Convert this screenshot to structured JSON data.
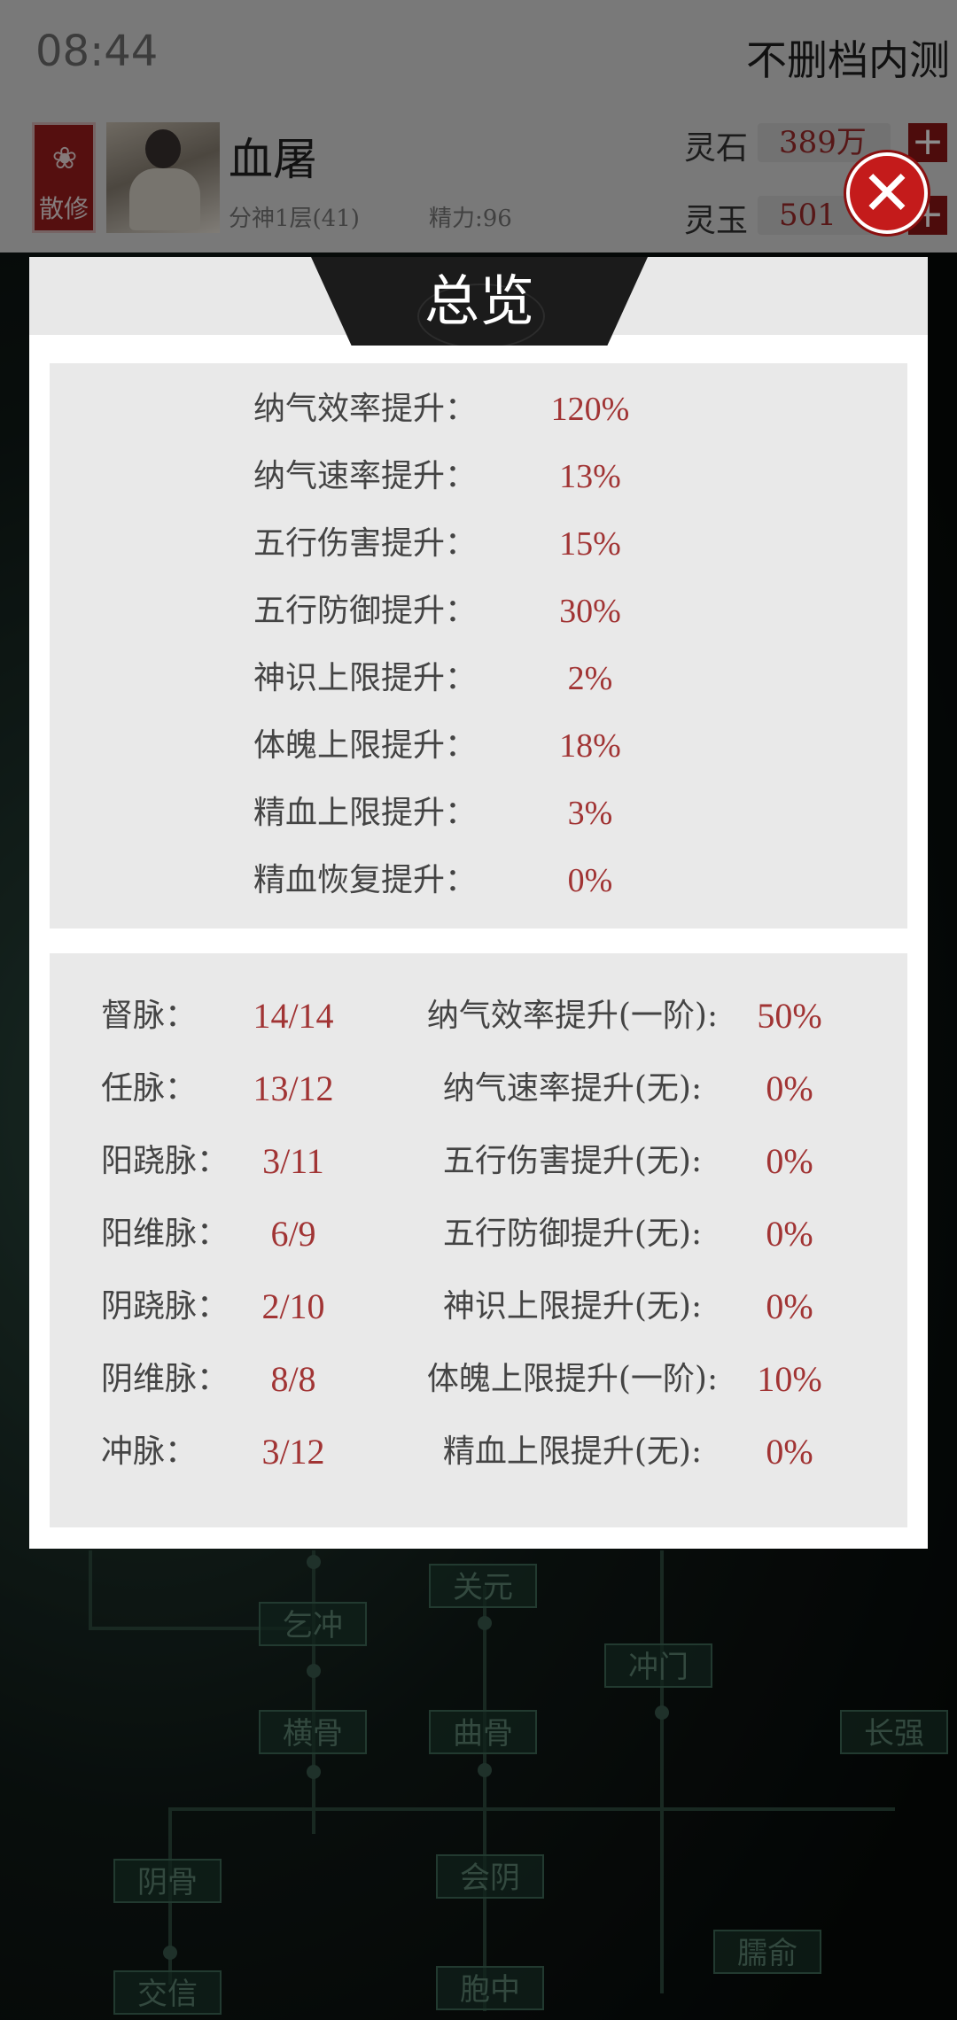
{
  "status_bar": {
    "time": "08:44",
    "server": "不删档内测"
  },
  "player": {
    "sect": "散修",
    "name": "血屠",
    "rank": "分神1层(41)",
    "energy": "精力:96"
  },
  "resources": [
    {
      "label": "灵石",
      "value": "389万"
    },
    {
      "label": "灵玉",
      "value": "501"
    }
  ],
  "background_nodes": [
    "乞冲",
    "关元",
    "冲门",
    "横骨",
    "曲骨",
    "长强",
    "阴骨",
    "会阴",
    "臑俞",
    "交信",
    "胞中"
  ],
  "dialog": {
    "title": "总览",
    "stats": [
      {
        "label": "纳气效率提升：",
        "value": "120%"
      },
      {
        "label": "纳气速率提升：",
        "value": "13%"
      },
      {
        "label": "五行伤害提升：",
        "value": "15%"
      },
      {
        "label": "五行防御提升：",
        "value": "30%"
      },
      {
        "label": "神识上限提升：",
        "value": "2%"
      },
      {
        "label": "体魄上限提升：",
        "value": "18%"
      },
      {
        "label": "精血上限提升：",
        "value": "3%"
      },
      {
        "label": "精血恢复提升：",
        "value": "0%"
      }
    ],
    "meridians": [
      {
        "name": "督脉：",
        "progress": "14/14",
        "effect": "纳气效率提升(一阶):",
        "effect_value": "50%"
      },
      {
        "name": "任脉：",
        "progress": "13/12",
        "effect": "纳气速率提升(无):",
        "effect_value": "0%"
      },
      {
        "name": "阳跷脉：",
        "progress": "3/11",
        "effect": "五行伤害提升(无):",
        "effect_value": "0%"
      },
      {
        "name": "阳维脉：",
        "progress": "6/9",
        "effect": "五行防御提升(无):",
        "effect_value": "0%"
      },
      {
        "name": "阴跷脉：",
        "progress": "2/10",
        "effect": "神识上限提升(无):",
        "effect_value": "0%"
      },
      {
        "name": "阴维脉：",
        "progress": "8/8",
        "effect": "体魄上限提升(一阶):",
        "effect_value": "10%"
      },
      {
        "name": "冲脉：",
        "progress": "3/12",
        "effect": "精血上限提升(无):",
        "effect_value": "0%"
      }
    ]
  },
  "colors": {
    "accent_red": "#a13434",
    "button_red": "#c41b1b",
    "title_tab": "#1b1b1b",
    "panel_gray": "#e9e9e9"
  },
  "icons": {
    "close": "close-icon",
    "add": "plus-icon",
    "sect": "lotus-icon"
  }
}
